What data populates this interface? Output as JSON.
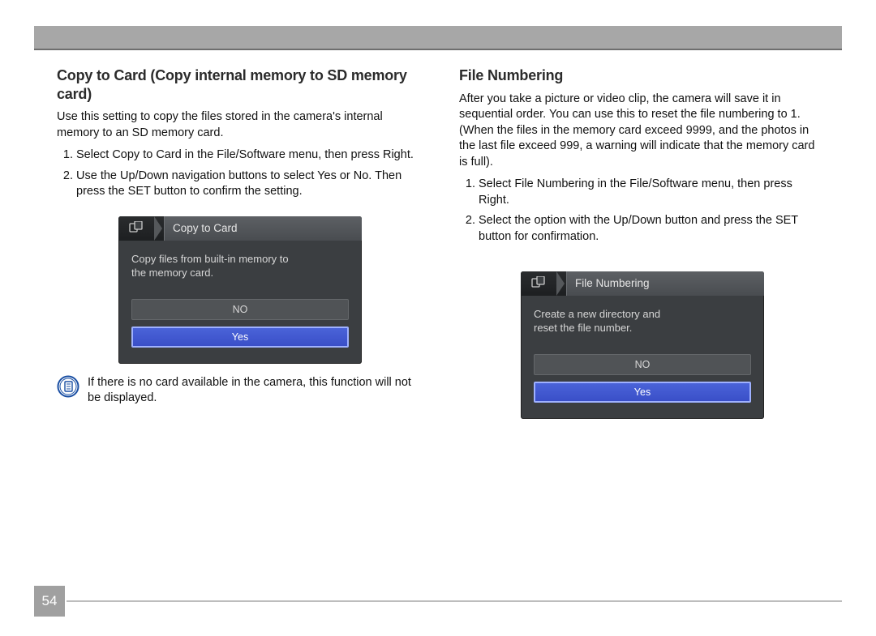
{
  "page_number": "54",
  "left": {
    "heading": "Copy to Card (Copy internal memory to SD memory card)",
    "intro": "Use this setting to copy the files stored in the camera's internal memory to an SD memory card.",
    "steps": [
      "Select Copy to Card in the File/Software menu, then press Right.",
      "Use the Up/Down navigation buttons to select Yes or No. Then press the SET button to confirm the setting."
    ],
    "note": "If there is no card available in the camera, this function will not be displayed.",
    "cam": {
      "title": "Copy to Card",
      "body_line1": "Copy files from built-in memory to",
      "body_line2": "the memory card.",
      "opt_no": "NO",
      "opt_yes": "Yes"
    }
  },
  "right": {
    "heading": "File Numbering",
    "intro": "After you take a picture or video clip, the camera will save it in sequential order. You can use this to reset the file numbering to 1. (When the files in the memory card exceed 9999, and the photos in the last file exceed 999, a warning will indicate that the memory card is full).",
    "steps": [
      "Select File Numbering in the File/Software menu, then press Right.",
      "Select the option with the Up/Down button and press the SET button for confirmation."
    ],
    "cam": {
      "title": "File Numbering",
      "body_line1": "Create a new directory and",
      "body_line2": "reset the file number.",
      "opt_no": "NO",
      "opt_yes": "Yes"
    }
  }
}
